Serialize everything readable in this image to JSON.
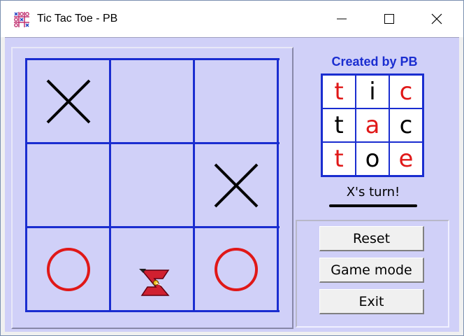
{
  "window": {
    "title": "Tic Tac Toe - PB",
    "controls": {
      "minimize": "minimize",
      "maximize": "maximize",
      "close": "close"
    }
  },
  "board": {
    "cells": [
      "X",
      "",
      "",
      "",
      "",
      "X",
      "O",
      "",
      "O"
    ],
    "colors": {
      "grid": "#1a2dd0",
      "x_mark": "#000000",
      "o_mark": "#e01818",
      "background": "#d0d0f8"
    },
    "cursor_icon": "z-logo-cursor-icon"
  },
  "side": {
    "created_by": "Created by PB",
    "logo": {
      "letters": [
        {
          "char": "t",
          "color": "#e01818"
        },
        {
          "char": "i",
          "color": "#000000"
        },
        {
          "char": "c",
          "color": "#e01818"
        },
        {
          "char": "t",
          "color": "#000000"
        },
        {
          "char": "a",
          "color": "#e01818"
        },
        {
          "char": "c",
          "color": "#000000"
        },
        {
          "char": "t",
          "color": "#e01818"
        },
        {
          "char": "o",
          "color": "#000000"
        },
        {
          "char": "e",
          "color": "#e01818"
        }
      ]
    },
    "turn": "X's turn!"
  },
  "buttons": {
    "reset": "Reset",
    "game_mode": "Game mode",
    "exit": "Exit"
  }
}
